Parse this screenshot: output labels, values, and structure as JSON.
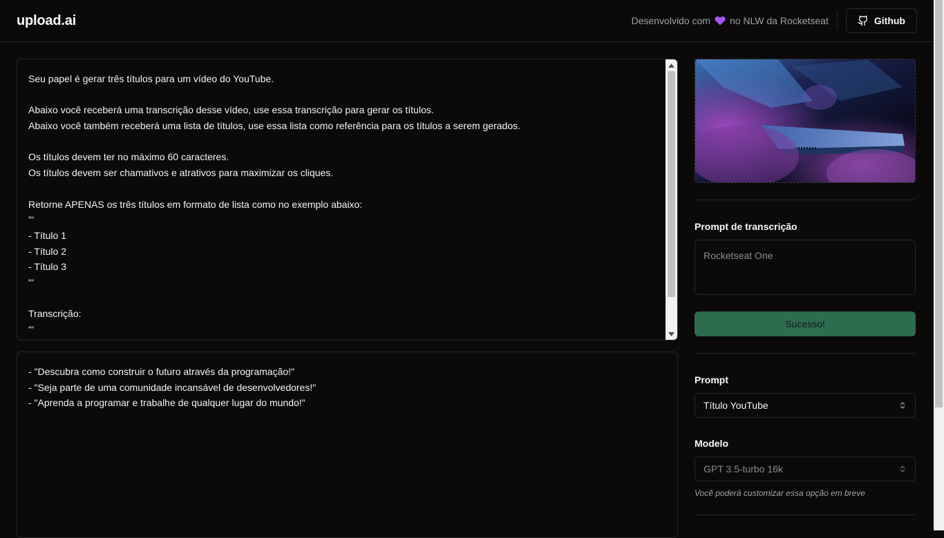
{
  "header": {
    "logo": "upload.ai",
    "credit_before": "Desenvolvido com",
    "credit_after": "no NLW da Rocketseat",
    "github_label": "Github"
  },
  "prompt_editor": {
    "lines": [
      "Seu papel é gerar três títulos para um vídeo do YouTube.",
      "",
      "Abaixo você receberá uma transcrição desse vídeo, use essa transcrição para gerar os títulos.",
      "Abaixo você também receberá uma lista de títulos, use essa lista como referência para os títulos a serem gerados.",
      "",
      "Os títulos devem ter no máximo 60 caracteres.",
      "Os títulos devem ser chamativos e atrativos para maximizar os cliques.",
      "",
      "Retorne APENAS os três títulos em formato de lista como no exemplo abaixo:",
      "'''",
      "- Título 1",
      "- Título 2",
      "- Título 3",
      "'''",
      "",
      "Transcrição:",
      "'''"
    ]
  },
  "result": {
    "lines": [
      "- \"Descubra como construir o futuro através da programação!\"",
      "- \"Seja parte de uma comunidade incansável de desenvolvedores!\"",
      "- \"Aprenda a programar e trabalhe de qualquer lugar do mundo!\""
    ]
  },
  "sidebar": {
    "transcription_label": "Prompt de transcrição",
    "transcription_value": "Rocketseat One",
    "upload_button": "Sucesso!",
    "prompt_label": "Prompt",
    "prompt_selected": "Título YouTube",
    "model_label": "Modelo",
    "model_selected": "GPT 3.5-turbo 16k",
    "model_hint": "Você poderá customizar essa opção em breve"
  },
  "colors": {
    "background": "#0b0a09",
    "border": "#27272a",
    "success": "#2e6c50",
    "heart": "#a855f7"
  }
}
